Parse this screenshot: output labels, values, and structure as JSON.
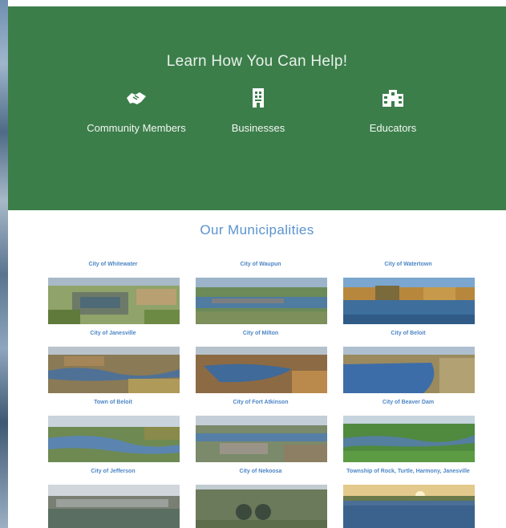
{
  "help": {
    "title": "Learn How You Can Help!",
    "items": [
      {
        "label": "Community Members",
        "icon": "handshake-icon"
      },
      {
        "label": "Businesses",
        "icon": "building-icon"
      },
      {
        "label": "Educators",
        "icon": "school-icon"
      }
    ],
    "background": "#3c7e4a"
  },
  "municipalities": {
    "title": "Our Municipalities",
    "accent": "#4d86c6",
    "items": [
      {
        "name": "City of Whitewater"
      },
      {
        "name": "City of Waupun"
      },
      {
        "name": "City of Watertown"
      },
      {
        "name": "City of Janesville"
      },
      {
        "name": "City of Milton"
      },
      {
        "name": "City of Beloit"
      },
      {
        "name": "Town of Beloit"
      },
      {
        "name": "City of Fort Atkinson"
      },
      {
        "name": "City of Beaver Dam"
      },
      {
        "name": "City of Jefferson"
      },
      {
        "name": "City of Nekoosa"
      },
      {
        "name": "Township of Rock, Turtle, Harmony, Janesville"
      }
    ]
  }
}
